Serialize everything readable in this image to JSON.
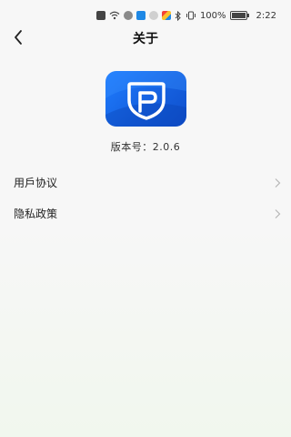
{
  "status_bar": {
    "battery_text": "100%",
    "time": "2:22",
    "icons": [
      "notification-icon",
      "wifi-icon",
      "app-icon",
      "app-icon",
      "app-icon",
      "app-icon",
      "bluetooth-icon",
      "vibrate-icon",
      "battery-icon"
    ]
  },
  "header": {
    "title": "关于",
    "back_icon": "chevron-left-icon"
  },
  "app": {
    "logo_icon": "app-logo-icon",
    "brand_color": "#1f7dff",
    "version_label": "版本号：2.0.6"
  },
  "menu": {
    "items": [
      {
        "label": "用戶协议",
        "icon": "chevron-right-icon"
      },
      {
        "label": "隐私政策",
        "icon": "chevron-right-icon"
      }
    ]
  }
}
